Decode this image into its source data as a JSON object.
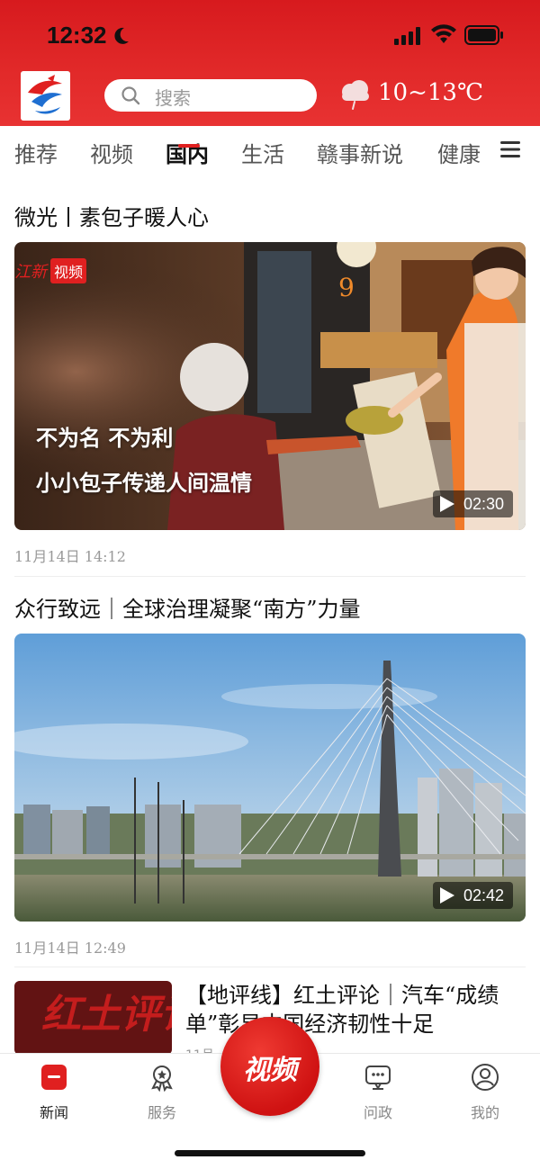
{
  "status_bar": {
    "time": "12:32"
  },
  "header": {
    "search_placeholder": "搜索",
    "weather": "10~13℃"
  },
  "tabs": [
    {
      "label": "推荐"
    },
    {
      "label": "视频"
    },
    {
      "label": "国内",
      "active": true
    },
    {
      "label": "生活"
    },
    {
      "label": "赣事新说"
    },
    {
      "label": "健康"
    }
  ],
  "articles": [
    {
      "title": "微光丨素包子暖人心",
      "video_badge": "视频",
      "overlay_line1": "不为名 不为利",
      "overlay_line2": "小小包子传递人间温情",
      "duration": "02:30",
      "time": "11月14日  14:12"
    },
    {
      "title": "众行致远｜全球治理凝聚“南方”力量",
      "duration": "02:42",
      "time": "11月14日  12:49"
    },
    {
      "title": "【地评线】红土评论｜汽车“成绩单”彰显中国经济韧性十足",
      "thumb_text": "红土评论",
      "time": "11月"
    }
  ],
  "bottom_nav": [
    {
      "label": "新闻",
      "icon": "news-icon",
      "active": true
    },
    {
      "label": "服务",
      "icon": "service-icon"
    },
    {
      "label": "问政",
      "icon": "inquiry-icon"
    },
    {
      "label": "我的",
      "icon": "profile-icon"
    }
  ],
  "video_button_label": "视频",
  "colors": {
    "brand_red": "#e02020",
    "header_red": "#d71a1e"
  }
}
